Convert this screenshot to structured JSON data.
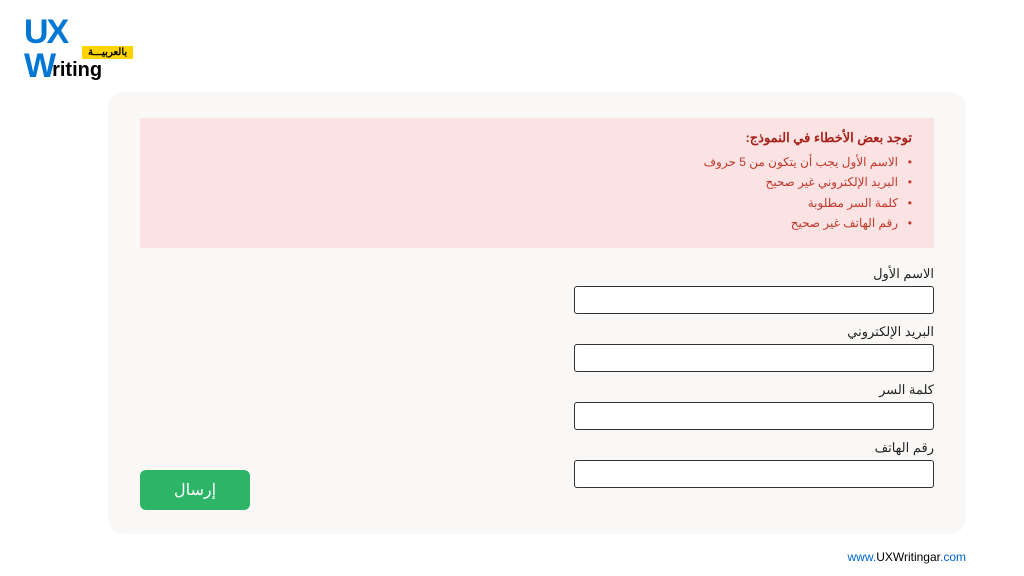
{
  "logo": {
    "ux": "UX",
    "w": "W",
    "riting": "riting",
    "tag": "بالعربيـــة"
  },
  "errors": {
    "title": "توجد بعض الأخطاء في النموذج:",
    "items": [
      "الاسم الأول يجب أن يتكون من 5 حروف",
      "البريد الإلكتروني غير صحيح",
      "كلمة السر مطلوبة",
      "رقم الهاتف غير صحيح"
    ]
  },
  "form": {
    "first_name": {
      "label": "الاسم الأول",
      "value": ""
    },
    "email": {
      "label": "البريد الإلكتروني",
      "value": ""
    },
    "password": {
      "label": "كلمة السر",
      "value": ""
    },
    "phone": {
      "label": "رقم الهاتف",
      "value": ""
    },
    "submit": "إرسال"
  },
  "footer": {
    "prefix": "www.",
    "domain": "UXWritingar",
    "suffix": ".com"
  }
}
